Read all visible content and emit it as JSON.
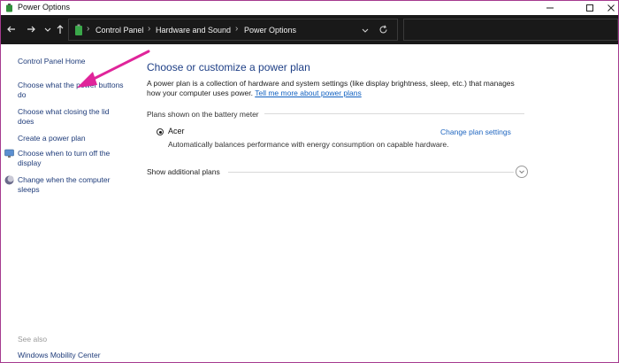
{
  "window": {
    "title": "Power Options",
    "buttons": [
      "minimize-icon",
      "maximize-icon",
      "close-icon"
    ]
  },
  "nav": {
    "back_icon": "arrow-left-icon",
    "forward_icon": "arrow-right-icon",
    "recent_icon": "chevron-down-icon",
    "up_icon": "arrow-up-icon"
  },
  "address": {
    "icon": "battery-icon",
    "breadcrumb": [
      "Control Panel",
      "Hardware and Sound",
      "Power Options"
    ],
    "dropdown_icon": "chevron-down-icon",
    "refresh_icon": "refresh-icon"
  },
  "sidebar": {
    "home": "Control Panel Home",
    "items": [
      {
        "label": "Choose what the power buttons do"
      },
      {
        "label": "Choose what closing the lid does"
      },
      {
        "label": "Create a power plan"
      },
      {
        "label": "Choose when to turn off the display",
        "icon": "display-icon"
      },
      {
        "label": "Change when the computer sleeps",
        "icon": "moon-icon"
      }
    ],
    "see_also": "See also",
    "see_also_items": [
      "Windows Mobility Center"
    ]
  },
  "main": {
    "heading": "Choose or customize a power plan",
    "description": "A power plan is a collection of hardware and system settings (like display brightness, sleep, etc.) that manages how your computer uses power.",
    "description_link": "Tell me more about power plans",
    "plans_label": "Plans shown on the battery meter",
    "plan": {
      "name": "Acer",
      "selected": true,
      "description": "Automatically balances performance with energy consumption on capable hardware.",
      "change_link": "Change plan settings"
    },
    "show_additional": "Show additional plans"
  },
  "colors": {
    "annotation_arrow": "#e0249a",
    "heading": "#1e3f86",
    "link": "#1f66c0",
    "navbar_bg": "#191919"
  }
}
